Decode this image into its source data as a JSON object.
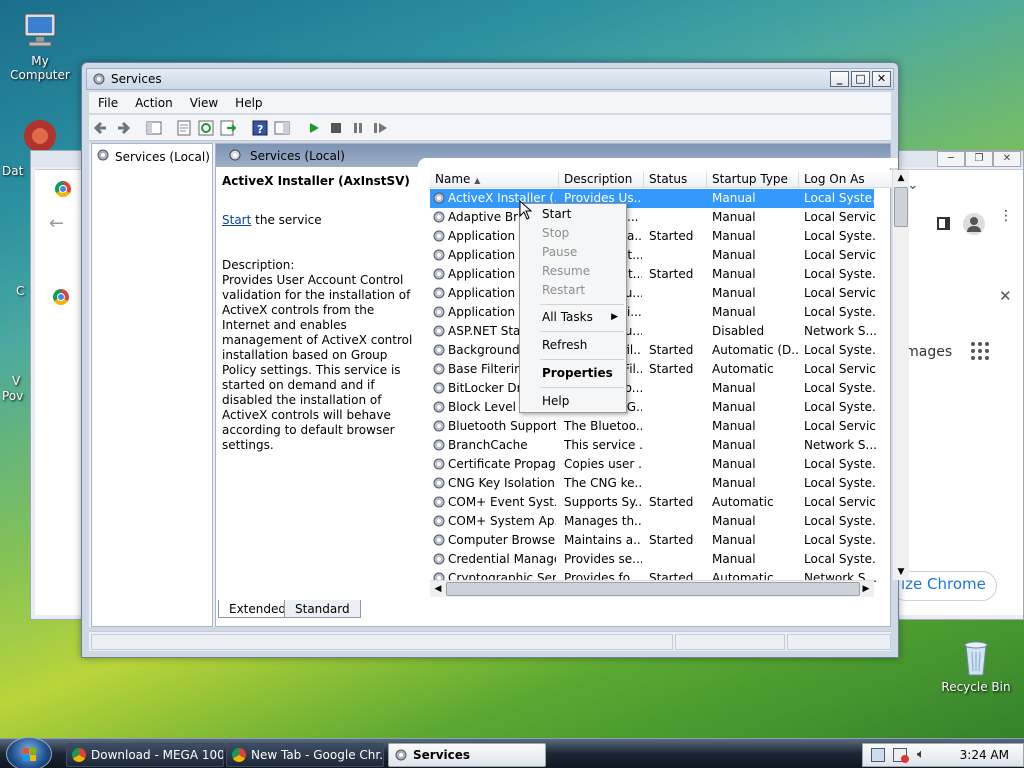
{
  "desktop": {
    "icons": [
      {
        "label": "My Computer"
      },
      {
        "label": "Recycle Bin"
      }
    ],
    "partial_labels": [
      "Dat",
      "V",
      "Pov",
      "C"
    ]
  },
  "chrome_background": {
    "visible_text": [
      "Images",
      "ize Chrome"
    ]
  },
  "window": {
    "title": "Services",
    "menu": [
      "File",
      "Action",
      "View",
      "Help"
    ],
    "tree_item": "Services (Local)",
    "content_header": "Services (Local)",
    "detail": {
      "service_name": "ActiveX Installer (AxInstSV)",
      "start_link": "Start",
      "start_rest": " the service",
      "description_label": "Description:",
      "description": "Provides User Account Control validation for the installation of ActiveX controls from the Internet and enables management of ActiveX control installation based on Group Policy settings. This service is started on demand and if disabled the installation of ActiveX controls will behave according to default browser settings."
    },
    "columns": [
      "Name",
      "Description",
      "Status",
      "Startup Type",
      "Log On As"
    ],
    "rows": [
      {
        "name": "ActiveX Installer (...",
        "desc": "Provides Us...",
        "status": "",
        "startup": "Manual",
        "logon": "Local Syste..."
      },
      {
        "name": "Adaptive Brig...",
        "desc": "Monitors a...",
        "status": "",
        "startup": "Manual",
        "logon": "Local Service"
      },
      {
        "name": "Application Exp...",
        "desc": "Processes a...",
        "status": "Started",
        "startup": "Manual",
        "logon": "Local Syste..."
      },
      {
        "name": "Application Ident...",
        "desc": "Determinat...",
        "status": "",
        "startup": "Manual",
        "logon": "Local Service"
      },
      {
        "name": "Application Info...",
        "desc": "Facilitates t...",
        "status": "Started",
        "startup": "Manual",
        "logon": "Local Syste..."
      },
      {
        "name": "Application Lay...",
        "desc": "Provides su...",
        "status": "",
        "startup": "Manual",
        "logon": "Local Service"
      },
      {
        "name": "Application Man...",
        "desc": "Processes i...",
        "status": "",
        "startup": "Manual",
        "logon": "Local Syste..."
      },
      {
        "name": "ASP.NET State...",
        "desc": "Provides su...",
        "status": "",
        "startup": "Disabled",
        "logon": "Network S..."
      },
      {
        "name": "Background Intel...",
        "desc": "Transfers fil...",
        "status": "Started",
        "startup": "Automatic (D...",
        "logon": "Local Syste..."
      },
      {
        "name": "Base Filtering E...",
        "desc": "The Base Fil...",
        "status": "Started",
        "startup": "Automatic",
        "logon": "Local Service"
      },
      {
        "name": "BitLocker Drive En...",
        "desc": "BDESVC ho...",
        "status": "",
        "startup": "Manual",
        "logon": "Local Syste..."
      },
      {
        "name": "Block Level Back...",
        "desc": "The WBENG...",
        "status": "",
        "startup": "Manual",
        "logon": "Local Syste..."
      },
      {
        "name": "Bluetooth Support...",
        "desc": "The Bluetoo...",
        "status": "",
        "startup": "Manual",
        "logon": "Local Service"
      },
      {
        "name": "BranchCache",
        "desc": "This service ...",
        "status": "",
        "startup": "Manual",
        "logon": "Network S..."
      },
      {
        "name": "Certificate Propag...",
        "desc": "Copies user ...",
        "status": "",
        "startup": "Manual",
        "logon": "Local Syste..."
      },
      {
        "name": "CNG Key Isolation",
        "desc": "The CNG ke...",
        "status": "",
        "startup": "Manual",
        "logon": "Local Syste..."
      },
      {
        "name": "COM+ Event Syst...",
        "desc": "Supports Sy...",
        "status": "Started",
        "startup": "Automatic",
        "logon": "Local Service"
      },
      {
        "name": "COM+ System Ap...",
        "desc": "Manages th...",
        "status": "",
        "startup": "Manual",
        "logon": "Local Syste..."
      },
      {
        "name": "Computer Browser",
        "desc": "Maintains a...",
        "status": "Started",
        "startup": "Manual",
        "logon": "Local Syste..."
      },
      {
        "name": "Credential Manager",
        "desc": "Provides se...",
        "status": "",
        "startup": "Manual",
        "logon": "Local Syste..."
      },
      {
        "name": "Cryptographic Ser...",
        "desc": "Provides fo...",
        "status": "Started",
        "startup": "Automatic",
        "logon": "Network S..."
      }
    ],
    "tabs": [
      "Extended",
      "Standard"
    ]
  },
  "context_menu": {
    "start": "Start",
    "stop": "Stop",
    "pause": "Pause",
    "resume": "Resume",
    "restart": "Restart",
    "all_tasks": "All Tasks",
    "refresh": "Refresh",
    "properties": "Properties",
    "help": "Help"
  },
  "taskbar": {
    "buttons": [
      {
        "label": "Download - MEGA 100..."
      },
      {
        "label": "New Tab - Google Chr..."
      },
      {
        "label": "Services"
      }
    ],
    "clock": "3:24 AM"
  },
  "colors": {
    "selection": "#3399ff",
    "link": "#0645ad",
    "accent_green": "#1a9a2a"
  }
}
